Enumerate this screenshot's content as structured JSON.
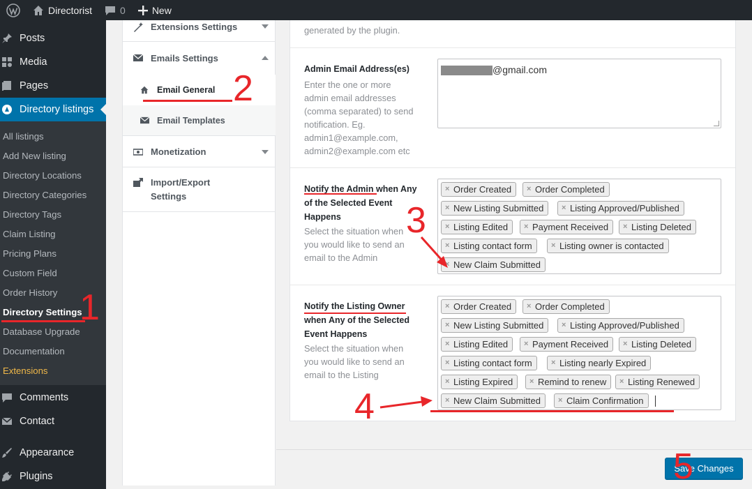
{
  "adminbar": {
    "site_name": "Directorist",
    "comments_count": "0",
    "new_label": "New"
  },
  "menu": {
    "posts": "Posts",
    "media": "Media",
    "pages": "Pages",
    "directory_listings": "Directory listings",
    "comments": "Comments",
    "contact": "Contact",
    "appearance": "Appearance",
    "plugins": "Plugins",
    "submenu": [
      "All listings",
      "Add New listing",
      "Directory Locations",
      "Directory Categories",
      "Directory Tags",
      "Claim Listing",
      "Pricing Plans",
      "Custom Field",
      "Order History",
      "Directory Settings",
      "Database Upgrade",
      "Documentation",
      "Extensions"
    ]
  },
  "settings_nav": {
    "extensions": "Extensions Settings",
    "emails": "Emails Settings",
    "email_general": "Email General",
    "email_templates": "Email Templates",
    "monetization": "Monetization",
    "import_export": "Import/Export",
    "import_export_2": "Settings"
  },
  "content": {
    "top_desc": "generated by the plugin.",
    "admin_email": {
      "label": "Admin Email Address(es)",
      "desc": [
        "Enter the one or more",
        "admin email addresses",
        "(comma separated) to send",
        "notification. Eg.",
        "admin1@example.com,",
        "admin2@example.com etc"
      ],
      "value_suffix": "@gmail.com"
    },
    "notify_admin": {
      "label_a": "Notify the Admin",
      "label_b": " when Any",
      "label_2": "of the Selected Event",
      "label_3": "Happens",
      "desc": [
        "Select the situation when",
        "you would like to send an",
        "email to the Admin"
      ],
      "tags": [
        "Order Created",
        "Order Completed",
        "New Listing Submitted",
        "Listing Approved/Published",
        "Listing Edited",
        "Payment Received",
        "Listing Deleted",
        "Listing contact form",
        "Listing owner is contacted",
        "New Claim Submitted"
      ]
    },
    "notify_owner": {
      "label_a": "Notify the Listing Owner",
      "label_2": "when Any of the Selected",
      "label_3": "Event Happens",
      "desc": [
        "Select the situation when",
        "you would like to send an",
        "email to the Listing"
      ],
      "tags": [
        "Order Created",
        "Order Completed",
        "New Listing Submitted",
        "Listing Approved/Published",
        "Listing Edited",
        "Payment Received",
        "Listing Deleted",
        "Listing contact form",
        "Listing nearly Expired",
        "Listing Expired",
        "Remind to renew",
        "Listing Renewed",
        "New Claim Submitted",
        "Claim Confirmation"
      ]
    },
    "save_label": "Save Changes"
  },
  "annotations": [
    "1",
    "2",
    "3",
    "4",
    "5"
  ],
  "colors": {
    "accent": "#0073aa",
    "annotation": "#e8262a",
    "menu_bg": "#23282d",
    "submenu_bg": "#32373c",
    "extensions": "#f0b849"
  }
}
